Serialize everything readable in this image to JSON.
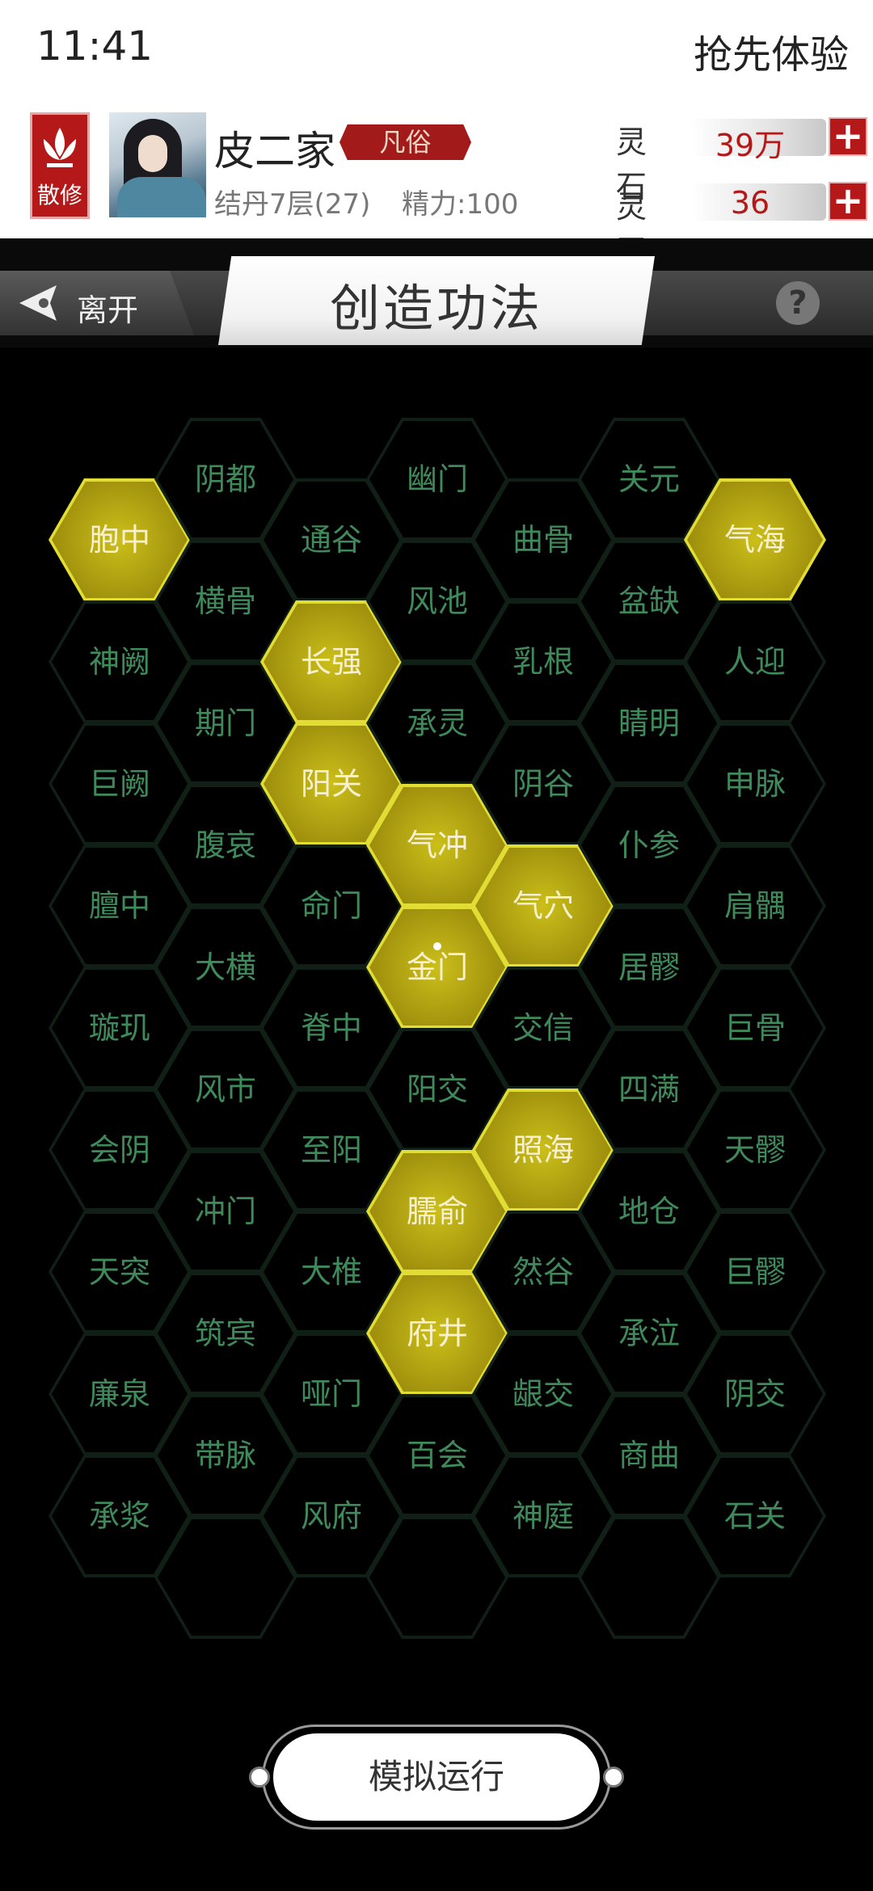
{
  "status_bar": {
    "time": "11:41",
    "trial_label": "抢先体验"
  },
  "profile": {
    "badge": "散修",
    "name": "皮二家",
    "rank": "凡俗",
    "realm": "结丹7层(27)",
    "energy": "精力:100",
    "spirit_stone": {
      "label": "灵石",
      "value": "39万"
    },
    "spirit_jade": {
      "label": "灵玉",
      "value": "36"
    }
  },
  "nav": {
    "leave_label": "离开",
    "title": "创造功法",
    "help": "?"
  },
  "grid": {
    "columns": [
      [
        "胞中",
        "神阙",
        "巨阙",
        "膻中",
        "璇玑",
        "会阴",
        "天突",
        "廉泉",
        "承浆"
      ],
      [
        "阴都",
        "横骨",
        "期门",
        "腹哀",
        "大横",
        "风市",
        "冲门",
        "筑宾",
        "带脉",
        ""
      ],
      [
        "通谷",
        "长强",
        "阳关",
        "命门",
        "脊中",
        "至阳",
        "大椎",
        "哑门",
        "风府"
      ],
      [
        "幽门",
        "风池",
        "承灵",
        "气冲",
        "金门",
        "阳交",
        "臑俞",
        "府井",
        "百会",
        ""
      ],
      [
        "曲骨",
        "乳根",
        "阴谷",
        "气穴",
        "交信",
        "照海",
        "然谷",
        "龈交",
        "神庭"
      ],
      [
        "关元",
        "盆缺",
        "睛明",
        "仆参",
        "居髎",
        "四满",
        "地仓",
        "承泣",
        "商曲",
        ""
      ],
      [
        "气海",
        "人迎",
        "申脉",
        "肩髃",
        "巨骨",
        "天髎",
        "巨髎",
        "阴交",
        "石关"
      ]
    ],
    "active": [
      "胞中",
      "气海",
      "长强",
      "阳关",
      "气冲",
      "气穴",
      "金门",
      "照海",
      "臑俞",
      "府井"
    ]
  },
  "simulate_button": "模拟运行"
}
